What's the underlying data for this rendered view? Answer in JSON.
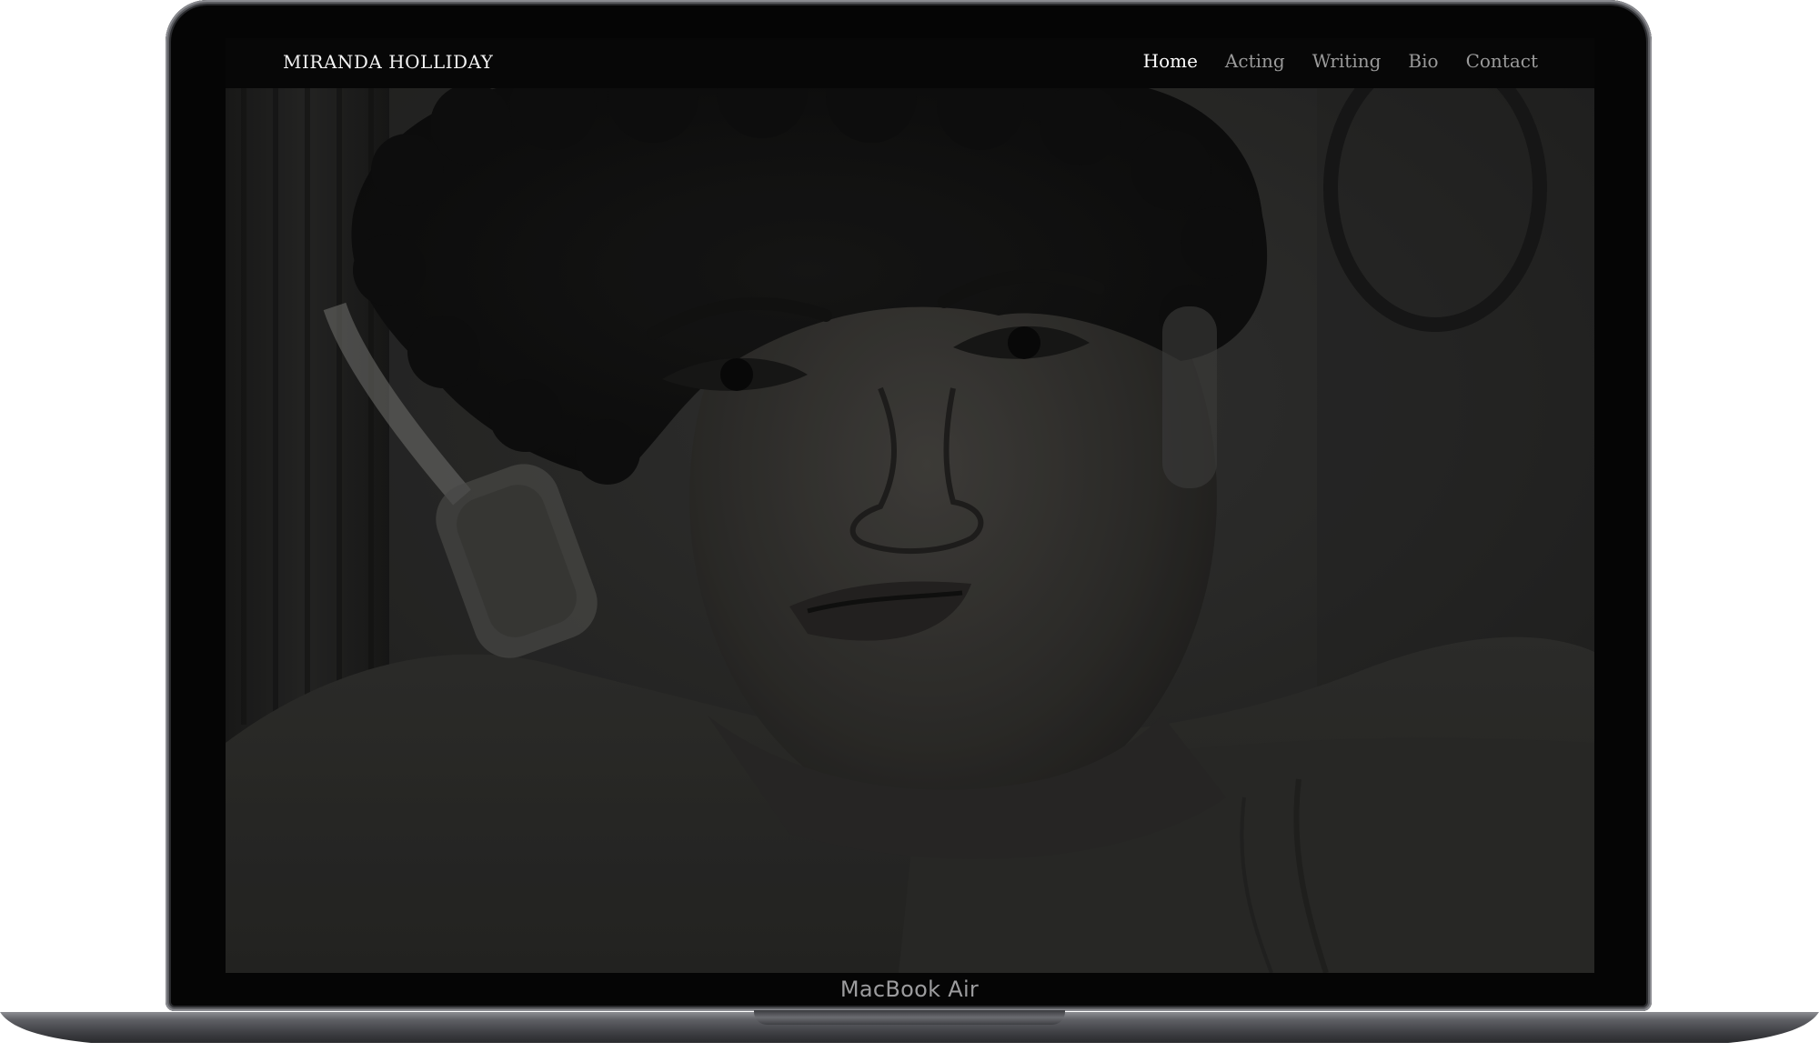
{
  "site": {
    "brand": "MIRANDA HOLLIDAY",
    "nav": [
      {
        "label": "Home",
        "active": true
      },
      {
        "label": "Acting",
        "active": false
      },
      {
        "label": "Writing",
        "active": false
      },
      {
        "label": "Bio",
        "active": false
      },
      {
        "label": "Contact",
        "active": false
      }
    ]
  },
  "device": {
    "label": "MacBook Air"
  },
  "colors": {
    "nav_background": "#070707",
    "nav_text": "#9a9a9a",
    "nav_active": "#ffffff",
    "hero_tint": "#2c2c2b"
  }
}
